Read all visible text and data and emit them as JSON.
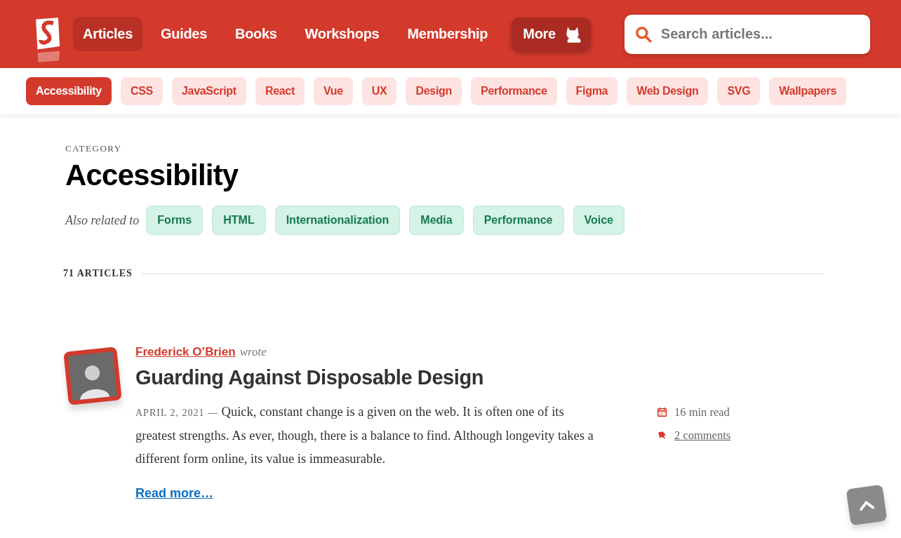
{
  "nav": {
    "items": [
      {
        "label": "Articles",
        "selected": true,
        "kind": "link"
      },
      {
        "label": "Guides",
        "selected": false,
        "kind": "link"
      },
      {
        "label": "Books",
        "selected": false,
        "kind": "link"
      },
      {
        "label": "Workshops",
        "selected": false,
        "kind": "link"
      },
      {
        "label": "Membership",
        "selected": false,
        "kind": "link"
      },
      {
        "label": "More",
        "selected": false,
        "kind": "more"
      }
    ],
    "search": {
      "placeholder": "Search articles..."
    }
  },
  "categories": [
    {
      "label": "Accessibility",
      "selected": true
    },
    {
      "label": "CSS",
      "selected": false
    },
    {
      "label": "JavaScript",
      "selected": false
    },
    {
      "label": "React",
      "selected": false
    },
    {
      "label": "Vue",
      "selected": false
    },
    {
      "label": "UX",
      "selected": false
    },
    {
      "label": "Design",
      "selected": false
    },
    {
      "label": "Performance",
      "selected": false
    },
    {
      "label": "Figma",
      "selected": false
    },
    {
      "label": "Web Design",
      "selected": false
    },
    {
      "label": "SVG",
      "selected": false
    },
    {
      "label": "Wallpapers",
      "selected": false
    }
  ],
  "page": {
    "eyebrow": "CATEGORY",
    "title": "Accessibility",
    "related_label": "Also related to",
    "related": [
      "Forms",
      "HTML",
      "Internationalization",
      "Media",
      "Performance",
      "Voice"
    ],
    "count": "71 ARTICLES"
  },
  "articles": [
    {
      "author": "Frederick O’Brien",
      "wrote": "wrote",
      "title": "Guarding Against Disposable Design",
      "date": "APRIL 2, 2021 —",
      "excerpt": "Quick, constant change is a given on the web. It is often one of its greatest strengths. As ever, though, there is a balance to find. Although longevity takes a different form online, its value is immeasurable.",
      "read_time": "16 min read",
      "comments": "2 comments",
      "read_more": "Read more…"
    }
  ]
}
